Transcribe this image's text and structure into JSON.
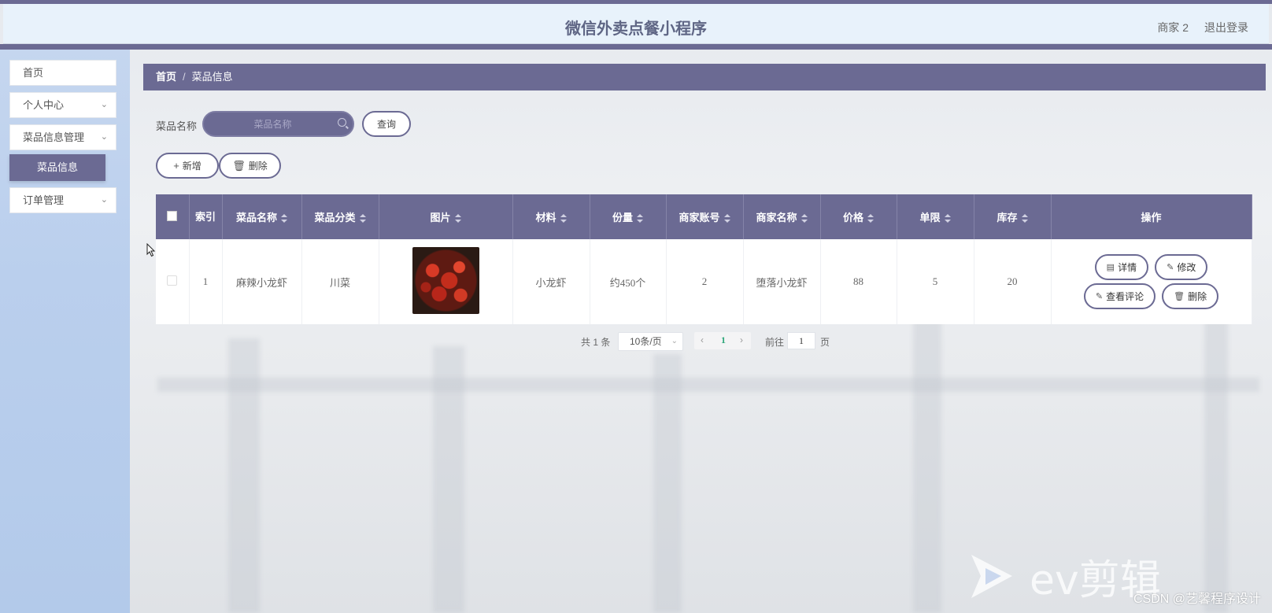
{
  "app": {
    "title": "微信外卖点餐小程序"
  },
  "header": {
    "user": "商家 2",
    "logout": "退出登录"
  },
  "sidebar": {
    "items": [
      {
        "label": "首页"
      },
      {
        "label": "个人中心"
      },
      {
        "label": "菜品信息管理"
      },
      {
        "label": "订单管理"
      }
    ],
    "active_sub": "菜品信息"
  },
  "breadcrumb": {
    "home": "首页",
    "current": "菜品信息"
  },
  "search": {
    "label": "菜品名称",
    "placeholder": "菜品名称",
    "button": "查询"
  },
  "actions": {
    "add": "新增",
    "delete": "删除"
  },
  "table": {
    "headers": [
      "索引",
      "菜品名称",
      "菜品分类",
      "图片",
      "材料",
      "份量",
      "商家账号",
      "商家名称",
      "价格",
      "单限",
      "库存",
      "操作"
    ],
    "rows": [
      {
        "index": "1",
        "name": "麻辣小龙虾",
        "category": "川菜",
        "image": "crayfish-photo",
        "material": "小龙虾",
        "portion": "约450个",
        "merchant_account": "2",
        "merchant_name": "堕落小龙虾",
        "price": "88",
        "limit": "5",
        "stock": "20"
      }
    ],
    "row_actions": {
      "detail": "详情",
      "edit": "修改",
      "reviews": "查看评论",
      "delete": "删除"
    }
  },
  "pagination": {
    "total": "共 1 条",
    "page_size": "10条/页",
    "current_page": "1",
    "goto_label": "前往",
    "goto_value": "1",
    "page_unit": "页"
  },
  "watermark": {
    "text": "CSDN @艺馨程序设计",
    "logo": "ev剪辑"
  },
  "colors": {
    "primary": "#6b6a93",
    "header_bg": "#e8f2fb",
    "sidebar_bg": "#bacfed"
  }
}
